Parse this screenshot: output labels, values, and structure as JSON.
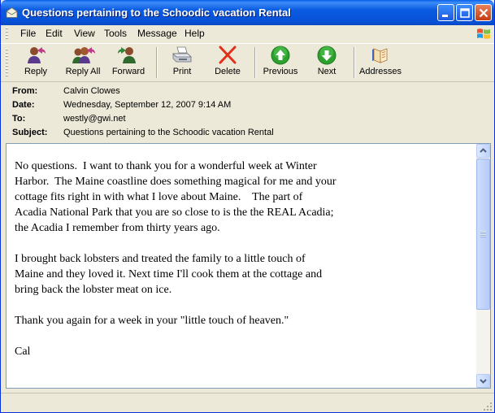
{
  "window": {
    "title": "Questions pertaining to the Schoodic vacation Rental"
  },
  "menu": [
    {
      "label": "File"
    },
    {
      "label": "Edit"
    },
    {
      "label": "View"
    },
    {
      "label": "Tools"
    },
    {
      "label": "Message"
    },
    {
      "label": "Help"
    }
  ],
  "toolbar": {
    "reply": "Reply",
    "reply_all": "Reply All",
    "forward": "Forward",
    "print": "Print",
    "delete": "Delete",
    "previous": "Previous",
    "next": "Next",
    "addresses": "Addresses"
  },
  "headers": {
    "from_label": "From:",
    "from": "Calvin Clowes",
    "date_label": "Date:",
    "date": "Wednesday, September 12, 2007 9:14 AM",
    "to_label": "To:",
    "to": "westly@gwi.net",
    "subject_label": "Subject:",
    "subject": "Questions pertaining to the Schoodic vacation Rental"
  },
  "body": {
    "paragraphs": [
      "No questions.  I want to thank you for a wonderful week at Winter\nHarbor.  The Maine coastline does something magical for me and your\ncottage fits right in with what I love about Maine.    The part of\nAcadia National Park that you are so close to is the the REAL Acadia;\nthe Acadia I remember from thirty years ago.",
      "I brought back lobsters and treated the family to a little touch of\nMaine and they loved it. Next time I'll cook them at the cottage and\nbring back the lobster meat on ice.",
      "Thank you again for a week in your \"little touch of heaven.\"",
      "Cal"
    ]
  },
  "colors": {
    "titlebar": "#0A5BE0",
    "chrome": "#ECE9D8",
    "arrow_green": "#2DA12D",
    "delete_red": "#E0301C"
  }
}
